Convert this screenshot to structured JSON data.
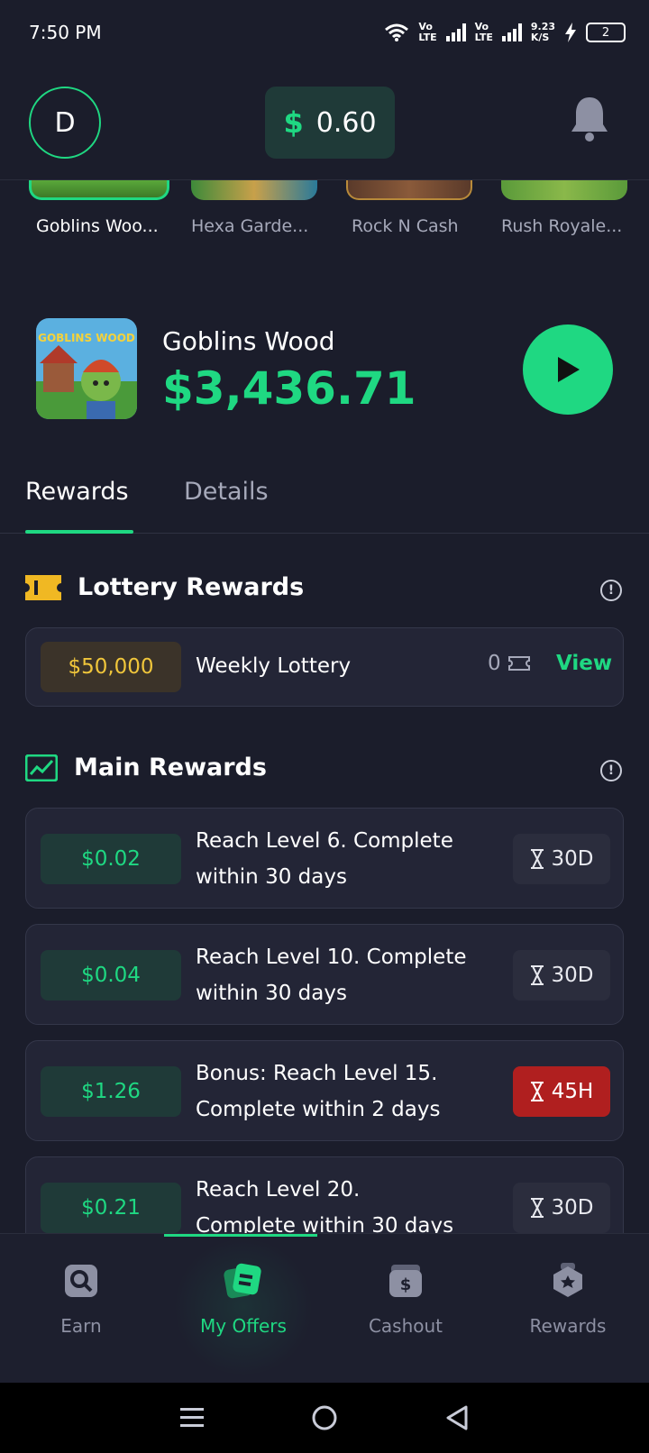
{
  "status_bar": {
    "time": "7:50 PM",
    "sim1_label_top": "Vo",
    "sim1_label_bottom": "LTE",
    "sim2_label_top": "Vo",
    "sim2_label_bottom": "LTE",
    "net_speed_top": "9.23",
    "net_speed_bottom": "K/S",
    "battery": "2"
  },
  "header": {
    "avatar_initial": "D",
    "balance_symbol": "$",
    "balance_value": "0.60"
  },
  "games_strip": {
    "items": [
      {
        "name": "Goblins Woo...",
        "active": true
      },
      {
        "name": "Hexa Garde...",
        "active": false
      },
      {
        "name": "Rock N Cash",
        "active": false
      },
      {
        "name": "Rush Royale...",
        "active": false
      }
    ]
  },
  "offer": {
    "title": "Goblins Wood",
    "amount": "$3,436.71",
    "icon_text": "GOBLINS WOOD"
  },
  "tabs": [
    {
      "label": "Rewards",
      "active": true
    },
    {
      "label": "Details",
      "active": false
    }
  ],
  "lottery": {
    "section_title": "Lottery Rewards",
    "info": "!",
    "prize": "$50,000",
    "name": "Weekly Lottery",
    "tickets": "0",
    "view_label": "View"
  },
  "main_rewards": {
    "section_title": "Main Rewards",
    "info": "!",
    "items": [
      {
        "amount": "$0.02",
        "line1": "Reach Level 6. Complete",
        "line2": "within 30 days",
        "time": "30D",
        "urgent": false
      },
      {
        "amount": "$0.04",
        "line1": "Reach Level 10. Complete",
        "line2": "within 30 days",
        "time": "30D",
        "urgent": false
      },
      {
        "amount": "$1.26",
        "line1": "Bonus: Reach Level 15.",
        "line2": "Complete within 2 days",
        "time": "45H",
        "urgent": true
      },
      {
        "amount": "$0.21",
        "line1": "Reach Level 20.",
        "line2": "Complete within 30 days",
        "time": "30D",
        "urgent": false
      }
    ]
  },
  "bottom_nav": {
    "items": [
      {
        "label": "Earn",
        "icon": "search-icon",
        "active": false
      },
      {
        "label": "My Offers",
        "icon": "offers-icon",
        "active": true
      },
      {
        "label": "Cashout",
        "icon": "wallet-icon",
        "active": false
      },
      {
        "label": "Rewards",
        "icon": "badge-icon",
        "active": false
      }
    ]
  },
  "colors": {
    "background": "#1b1d2b",
    "accent": "#1fd882",
    "gold": "#f0c63b",
    "urgent": "#b01f1f"
  }
}
